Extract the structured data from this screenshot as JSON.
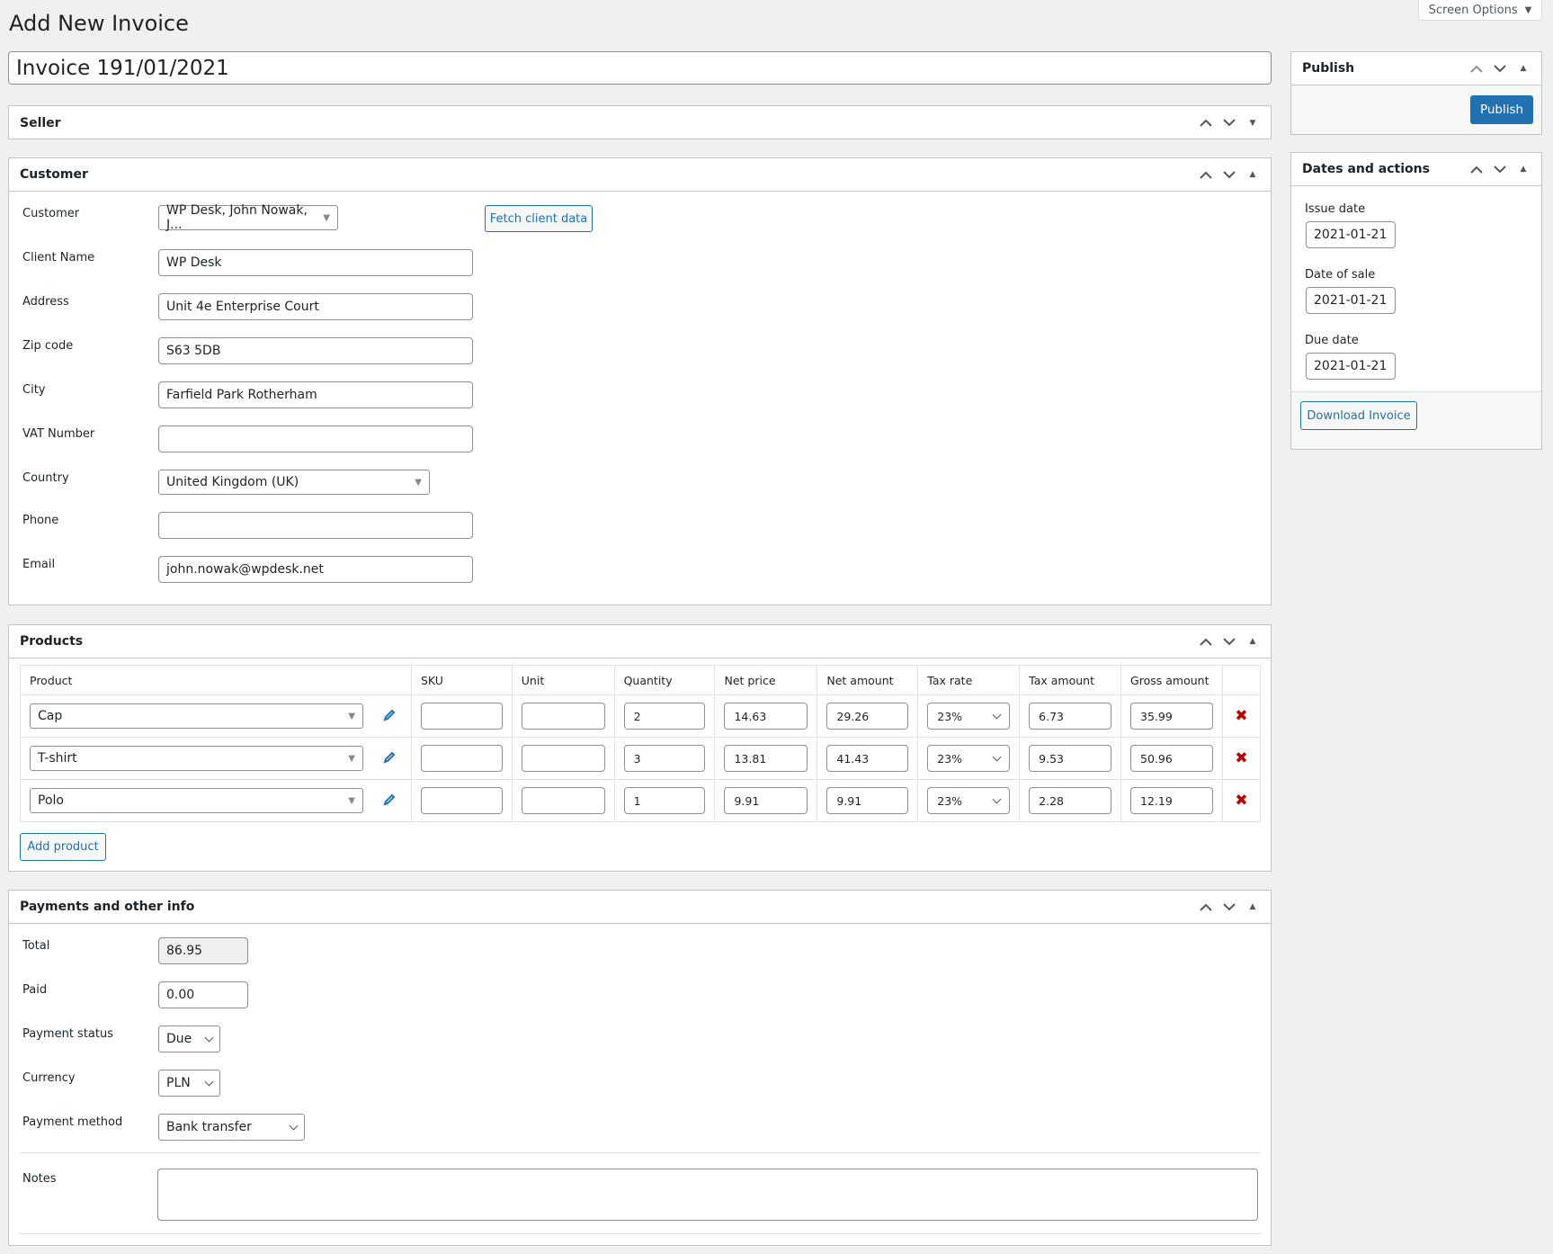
{
  "page": {
    "title": "Add New Invoice",
    "screen_options": "Screen Options",
    "invoice_title": "Invoice 191/01/2021"
  },
  "seller": {
    "title": "Seller"
  },
  "customer": {
    "title": "Customer",
    "fetch_button": "Fetch client data",
    "fields": [
      {
        "label": "Customer",
        "value": "WP Desk, John Nowak, J..."
      },
      {
        "label": "Client Name",
        "value": "WP Desk"
      },
      {
        "label": "Address",
        "value": "Unit 4e Enterprise Court"
      },
      {
        "label": "Zip code",
        "value": "S63 5DB"
      },
      {
        "label": "City",
        "value": "Farfield Park Rotherham"
      },
      {
        "label": "VAT Number",
        "value": ""
      },
      {
        "label": "Country",
        "value": "United Kingdom (UK)"
      },
      {
        "label": "Phone",
        "value": ""
      },
      {
        "label": "Email",
        "value": "john.nowak@wpdesk.net"
      }
    ]
  },
  "products": {
    "title": "Products",
    "add_button": "Add product",
    "columns": [
      "Product",
      "SKU",
      "Unit",
      "Quantity",
      "Net price",
      "Net amount",
      "Tax rate",
      "Tax amount",
      "Gross amount"
    ],
    "rows": [
      {
        "product": "Cap",
        "sku": "",
        "unit": "",
        "quantity": "2",
        "net_price": "14.63",
        "net_amount": "29.26",
        "tax_rate": "23%",
        "tax_amount": "6.73",
        "gross_amount": "35.99"
      },
      {
        "product": "T-shirt",
        "sku": "",
        "unit": "",
        "quantity": "3",
        "net_price": "13.81",
        "net_amount": "41.43",
        "tax_rate": "23%",
        "tax_amount": "9.53",
        "gross_amount": "50.96"
      },
      {
        "product": "Polo",
        "sku": "",
        "unit": "",
        "quantity": "1",
        "net_price": "9.91",
        "net_amount": "9.91",
        "tax_rate": "23%",
        "tax_amount": "2.28",
        "gross_amount": "12.19"
      }
    ]
  },
  "payments": {
    "title": "Payments and other info",
    "total_label": "Total",
    "total": "86.95",
    "paid_label": "Paid",
    "paid": "0.00",
    "status_label": "Payment status",
    "status": "Due",
    "currency_label": "Currency",
    "currency": "PLN",
    "method_label": "Payment method",
    "method": "Bank transfer",
    "notes_label": "Notes",
    "notes": ""
  },
  "publish": {
    "title": "Publish",
    "button": "Publish"
  },
  "dates": {
    "title": "Dates and actions",
    "issue_label": "Issue date",
    "issue": "2021-01-21",
    "sale_label": "Date of sale",
    "sale": "2021-01-21",
    "due_label": "Due date",
    "due": "2021-01-21",
    "download_button": "Download Invoice"
  },
  "colors": {
    "primary": "#2271b1",
    "delete": "#b30000",
    "background": "#f0f0f1"
  }
}
